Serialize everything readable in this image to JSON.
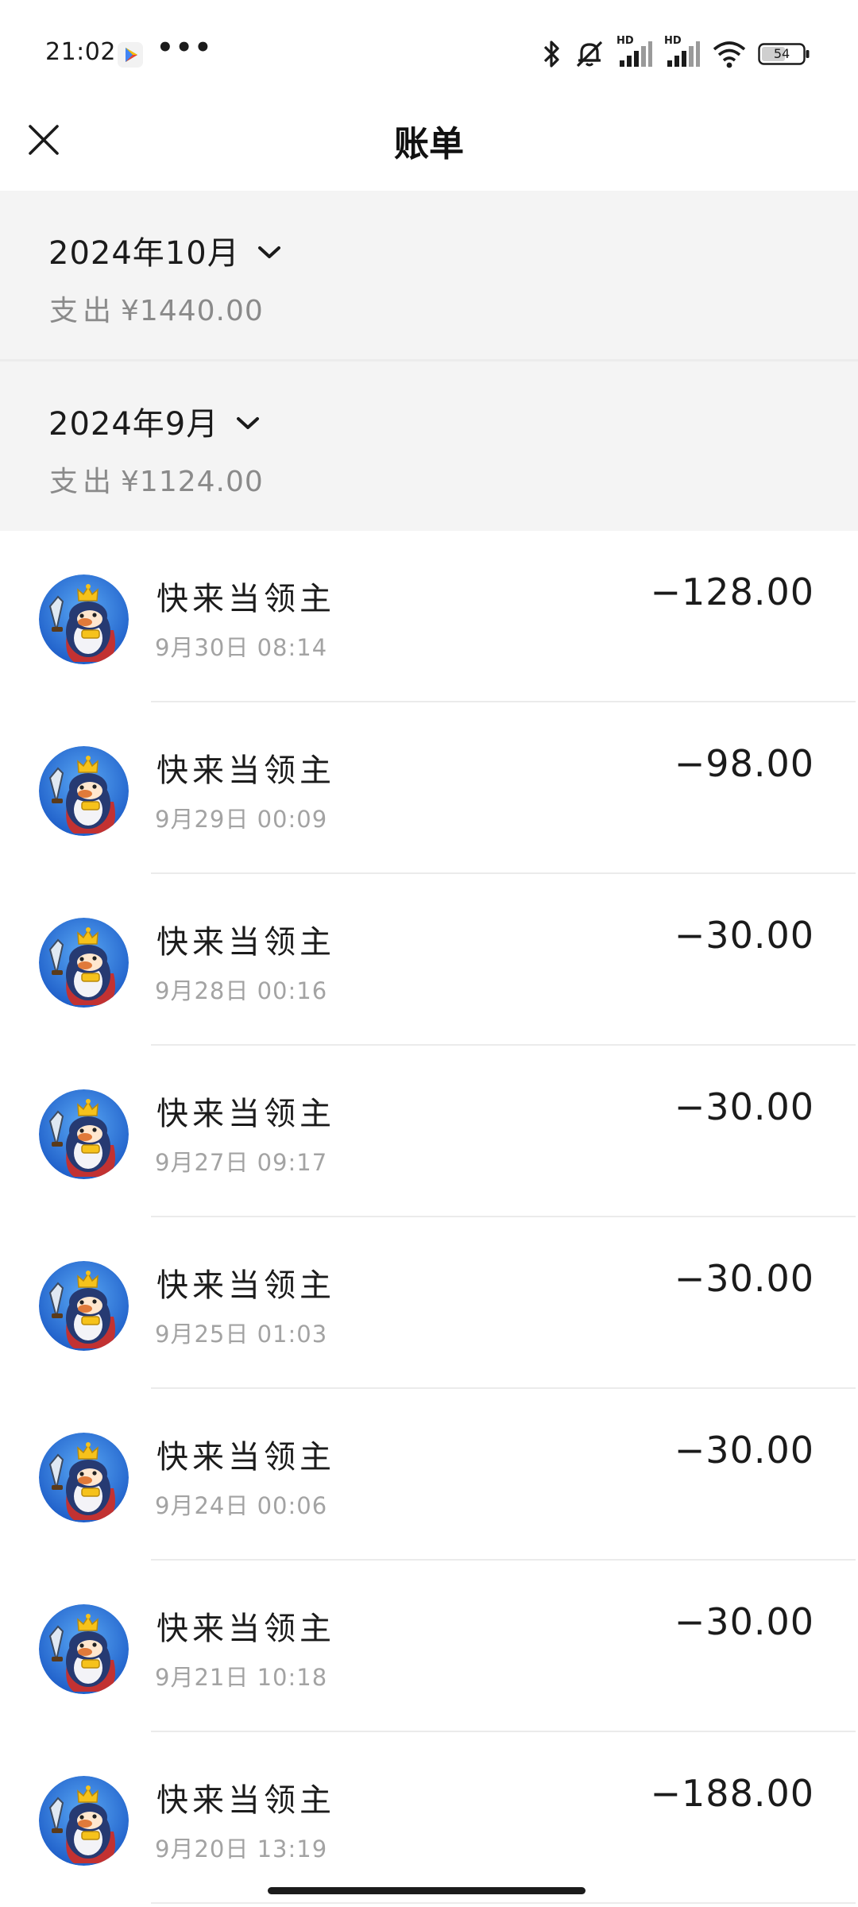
{
  "status_bar": {
    "time": "21:02",
    "more_dots": "•••",
    "battery": "54",
    "hd1": "HD",
    "hd2": "HD"
  },
  "header": {
    "title": "账单",
    "close_icon": "close-icon"
  },
  "months": [
    {
      "title": "2024年10月",
      "expense_label": "支出",
      "expense_value": "¥1440.00"
    },
    {
      "title": "2024年9月",
      "expense_label": "支出",
      "expense_value": "¥1124.00"
    }
  ],
  "transactions": [
    {
      "name": "快来当领主",
      "time": "9月30日  08:14",
      "amount": "−128.00"
    },
    {
      "name": "快来当领主",
      "time": "9月29日  00:09",
      "amount": "−98.00"
    },
    {
      "name": "快来当领主",
      "time": "9月28日  00:16",
      "amount": "−30.00"
    },
    {
      "name": "快来当领主",
      "time": "9月27日  09:17",
      "amount": "−30.00"
    },
    {
      "name": "快来当领主",
      "time": "9月25日  01:03",
      "amount": "−30.00"
    },
    {
      "name": "快来当领主",
      "time": "9月24日  00:06",
      "amount": "−30.00"
    },
    {
      "name": "快来当领主",
      "time": "9月21日  10:18",
      "amount": "−30.00"
    },
    {
      "name": "快来当领主",
      "time": "9月20日  13:19",
      "amount": "−188.00"
    }
  ],
  "colors": {
    "section_bg": "#f4f4f4",
    "secondary_text": "#8a8a8a",
    "avatar_blue": "#2e6fd9",
    "crown_yellow": "#f6c21b"
  }
}
